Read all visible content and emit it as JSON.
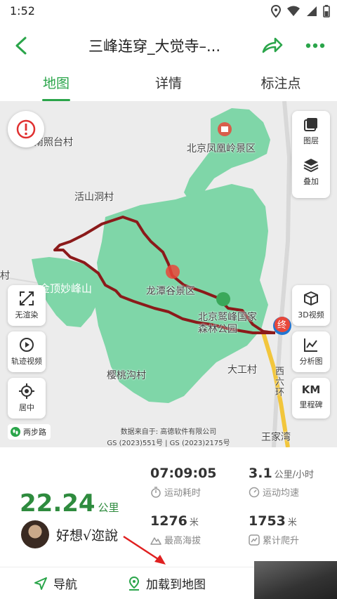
{
  "status_bar": {
    "time": "1:52"
  },
  "header": {
    "title": "三峰连穿_大觉寺–..."
  },
  "tabs": [
    {
      "label": "地图",
      "active": true
    },
    {
      "label": "详情",
      "active": false
    },
    {
      "label": "标注点",
      "active": false
    }
  ],
  "map": {
    "places": {
      "nanzhao": "南照台村",
      "fenghuangling": "北京凤凰岭景区",
      "huoshan": "活山洞村",
      "goucun": "沟村",
      "miaofeng": "金顶妙峰山",
      "longtan": "龙潭谷景区",
      "jiufeng": "北京鹫峰国家森林公园",
      "yingtao": "樱桃沟村",
      "dagong": "大工村",
      "wangjiawan": "王家湾",
      "ring_road": "西六环",
      "end_marker": "终"
    },
    "controls": {
      "layers": "图层",
      "overlay": "叠加",
      "no_render": "无渲染",
      "track_video": "轨迹视频",
      "center": "居中",
      "video_3d": "3D视频",
      "analysis": "分析图",
      "km_marker_icon": "KM",
      "km_marker": "里程碑"
    },
    "walk_badge": "两步路",
    "attribution_line1": "数据来自于: 高德软件有限公司",
    "attribution_line2": "GS (2023)551号 | GS (2023)2175号"
  },
  "stats": {
    "distance": "22.24",
    "distance_unit": "公里",
    "user_name": "好想√迩說",
    "duration": {
      "value": "07:09:05",
      "label": "运动耗时"
    },
    "speed": {
      "value": "3.1",
      "unit": "公里/小时",
      "label": "运动均速"
    },
    "max_altitude": {
      "value": "1276",
      "unit": "米",
      "label": "最高海拔"
    },
    "total_climb": {
      "value": "1753",
      "unit": "米",
      "label": "累计爬升"
    }
  },
  "actions": {
    "navigate": "导航",
    "load_to_map": "加载到地图"
  },
  "colors": {
    "accent": "#2aa54a",
    "distance": "#2e8b3e",
    "track": "#8b1a1a",
    "park": "#7fd6a8",
    "end_marker": "#e8483a",
    "annotation_arrow": "#e02020"
  }
}
